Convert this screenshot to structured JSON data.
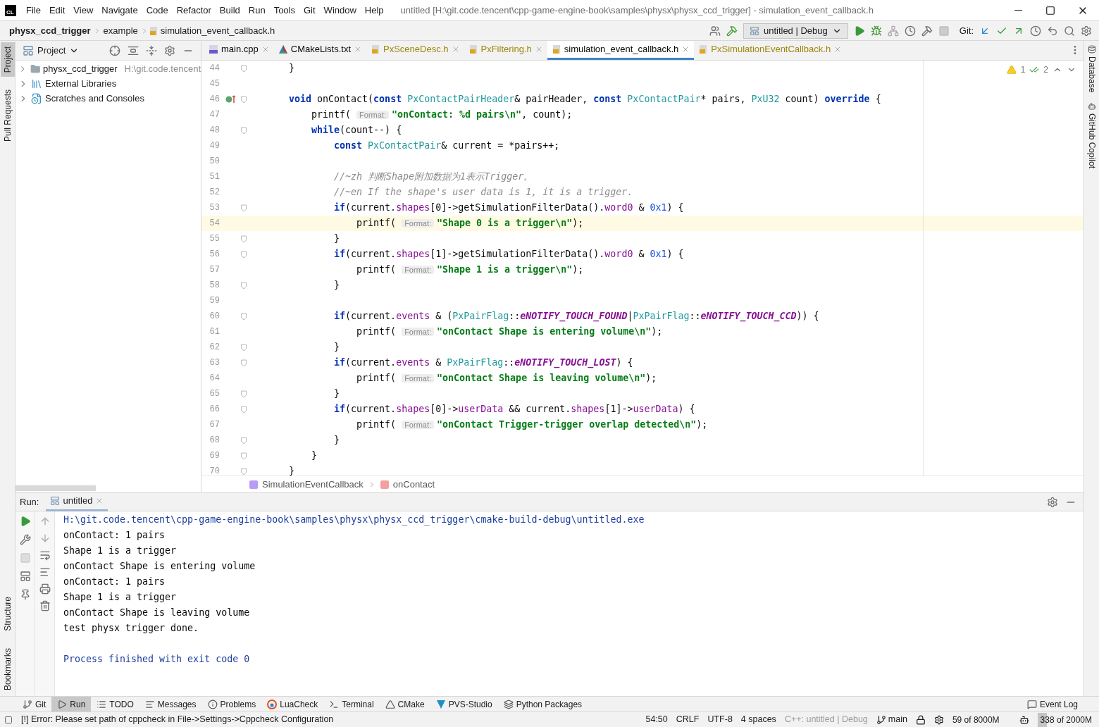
{
  "logo": "CL",
  "menu": [
    "File",
    "Edit",
    "View",
    "Navigate",
    "Code",
    "Refactor",
    "Build",
    "Run",
    "Tools",
    "Git",
    "Window",
    "Help"
  ],
  "window": {
    "title": "untitled [H:\\git.code.tencent\\cpp-game-engine-book\\samples\\physx\\physx_ccd_trigger] - simulation_event_callback.h"
  },
  "breadcrumbs": [
    "physx_ccd_trigger",
    "example",
    "simulation_event_callback.h"
  ],
  "run_config": "untitled | Debug",
  "git_label": "Git:",
  "left_stripe": [
    {
      "label": "Project",
      "selected": true
    },
    {
      "label": "Pull Requests",
      "selected": false
    },
    {
      "label": "Structure",
      "selected": false
    },
    {
      "label": "Bookmarks",
      "selected": false
    }
  ],
  "right_stripe": [
    "Database",
    "GitHub Copilot"
  ],
  "project": {
    "title": "Project",
    "items": [
      {
        "label": "physx_ccd_trigger",
        "hint": "H:\\git.code.tencent",
        "kind": "folder"
      },
      {
        "label": "External Libraries",
        "kind": "library"
      },
      {
        "label": "Scratches and Consoles",
        "kind": "scratch"
      }
    ]
  },
  "tabs": [
    {
      "label": "main.cpp",
      "kind": "cpp",
      "selected": false,
      "color": "#080808"
    },
    {
      "label": "CMakeLists.txt",
      "kind": "cmake",
      "selected": false,
      "color": "#080808"
    },
    {
      "label": "PxSceneDesc.h",
      "kind": "h",
      "selected": false,
      "color": "#9e880d"
    },
    {
      "label": "PxFiltering.h",
      "kind": "h",
      "selected": false,
      "color": "#9e880d"
    },
    {
      "label": "simulation_event_callback.h",
      "kind": "h",
      "selected": true,
      "color": "#080808"
    },
    {
      "label": "PxSimulationEventCallback.h",
      "kind": "h",
      "selected": false,
      "color": "#9e880d"
    }
  ],
  "inspections": {
    "warnings": "1",
    "checks": "2"
  },
  "code": [
    {
      "n": "44",
      "fold": true,
      "override": false,
      "current": false,
      "tokens": [
        {
          "kind": "plain",
          "text": "    }"
        }
      ]
    },
    {
      "n": "45",
      "fold": false,
      "override": false,
      "current": false
    },
    {
      "n": "46",
      "fold": true,
      "override": true,
      "current": false,
      "tokens": [
        {
          "kind": "keyword",
          "text": "    void"
        },
        {
          "kind": "plain",
          "text": " onContact("
        },
        {
          "kind": "keyword",
          "text": "const"
        },
        {
          "kind": "type",
          "text": " PxContactPairHeader"
        },
        {
          "kind": "plain",
          "text": "& pairHeader, "
        },
        {
          "kind": "keyword",
          "text": "const"
        },
        {
          "kind": "type",
          "text": " PxContactPair"
        },
        {
          "kind": "plain",
          "text": "* pairs, "
        },
        {
          "kind": "type",
          "text": "PxU32"
        },
        {
          "kind": "plain",
          "text": " count) "
        },
        {
          "kind": "keyword",
          "text": "override"
        },
        {
          "kind": "plain",
          "text": " {"
        }
      ]
    },
    {
      "n": "47",
      "fold": false,
      "override": false,
      "current": false,
      "tokens": [
        {
          "kind": "plain",
          "text": "        printf( "
        },
        {
          "kind": "hint",
          "text": "Format:"
        },
        {
          "kind": "string",
          "text": "\"onContact: %d pairs\\n\""
        },
        {
          "kind": "plain",
          "text": ", count);"
        }
      ]
    },
    {
      "n": "48",
      "fold": true,
      "override": false,
      "current": false,
      "tokens": [
        {
          "kind": "keyword",
          "text": "        while"
        },
        {
          "kind": "plain",
          "text": "(count--) {"
        }
      ]
    },
    {
      "n": "49",
      "fold": false,
      "override": false,
      "current": false,
      "tokens": [
        {
          "kind": "keyword",
          "text": "            const"
        },
        {
          "kind": "type",
          "text": " PxContactPair"
        },
        {
          "kind": "plain",
          "text": "& current = *pairs++;"
        }
      ]
    },
    {
      "n": "50",
      "fold": false,
      "override": false,
      "current": false
    },
    {
      "n": "51",
      "fold": false,
      "override": false,
      "current": false,
      "tokens": [
        {
          "kind": "comment",
          "text": "            //~zh 判断Shape附加数据为1表示Trigger。"
        }
      ]
    },
    {
      "n": "52",
      "fold": false,
      "override": false,
      "current": false,
      "tokens": [
        {
          "kind": "comment",
          "text": "            //~en If the shape's user data is 1, it is a trigger."
        }
      ]
    },
    {
      "n": "53",
      "fold": true,
      "override": false,
      "current": false,
      "tokens": [
        {
          "kind": "keyword",
          "text": "            if"
        },
        {
          "kind": "plain",
          "text": "(current."
        },
        {
          "kind": "field",
          "text": "shapes"
        },
        {
          "kind": "plain",
          "text": "[0]->getSimulationFilterData()."
        },
        {
          "kind": "field",
          "text": "word0"
        },
        {
          "kind": "plain",
          "text": " & "
        },
        {
          "kind": "number",
          "text": "0x1"
        },
        {
          "kind": "plain",
          "text": ") {"
        }
      ]
    },
    {
      "n": "54",
      "fold": false,
      "override": false,
      "current": true,
      "tokens": [
        {
          "kind": "plain",
          "text": "                printf( "
        },
        {
          "kind": "hint",
          "text": "Format:"
        },
        {
          "kind": "string",
          "text": "\"Shape 0 is a trigger\\n\""
        },
        {
          "kind": "plain",
          "text": ");"
        }
      ]
    },
    {
      "n": "55",
      "fold": true,
      "override": false,
      "current": false,
      "tokens": [
        {
          "kind": "plain",
          "text": "            }"
        }
      ]
    },
    {
      "n": "56",
      "fold": true,
      "override": false,
      "current": false,
      "tokens": [
        {
          "kind": "keyword",
          "text": "            if"
        },
        {
          "kind": "plain",
          "text": "(current."
        },
        {
          "kind": "field",
          "text": "shapes"
        },
        {
          "kind": "plain",
          "text": "[1]->getSimulationFilterData()."
        },
        {
          "kind": "field",
          "text": "word0"
        },
        {
          "kind": "plain",
          "text": " & "
        },
        {
          "kind": "number",
          "text": "0x1"
        },
        {
          "kind": "plain",
          "text": ") {"
        }
      ]
    },
    {
      "n": "57",
      "fold": false,
      "override": false,
      "current": false,
      "tokens": [
        {
          "kind": "plain",
          "text": "                printf( "
        },
        {
          "kind": "hint",
          "text": "Format:"
        },
        {
          "kind": "string",
          "text": "\"Shape 1 is a trigger\\n\""
        },
        {
          "kind": "plain",
          "text": ");"
        }
      ]
    },
    {
      "n": "58",
      "fold": true,
      "override": false,
      "current": false,
      "tokens": [
        {
          "kind": "plain",
          "text": "            }"
        }
      ]
    },
    {
      "n": "59",
      "fold": false,
      "override": false,
      "current": false
    },
    {
      "n": "60",
      "fold": true,
      "override": false,
      "current": false,
      "tokens": [
        {
          "kind": "keyword",
          "text": "            if"
        },
        {
          "kind": "plain",
          "text": "(current."
        },
        {
          "kind": "field",
          "text": "events"
        },
        {
          "kind": "plain",
          "text": " & ("
        },
        {
          "kind": "type",
          "text": "PxPairFlag"
        },
        {
          "kind": "plain",
          "text": "::"
        },
        {
          "kind": "enum",
          "text": "eNOTIFY_TOUCH_FOUND"
        },
        {
          "kind": "plain",
          "text": "|"
        },
        {
          "kind": "type",
          "text": "PxPairFlag"
        },
        {
          "kind": "plain",
          "text": "::"
        },
        {
          "kind": "enum",
          "text": "eNOTIFY_TOUCH_CCD"
        },
        {
          "kind": "plain",
          "text": ")) {"
        }
      ]
    },
    {
      "n": "61",
      "fold": false,
      "override": false,
      "current": false,
      "tokens": [
        {
          "kind": "plain",
          "text": "                printf( "
        },
        {
          "kind": "hint",
          "text": "Format:"
        },
        {
          "kind": "string",
          "text": "\"onContact Shape is entering volume\\n\""
        },
        {
          "kind": "plain",
          "text": ");"
        }
      ]
    },
    {
      "n": "62",
      "fold": true,
      "override": false,
      "current": false,
      "tokens": [
        {
          "kind": "plain",
          "text": "            }"
        }
      ]
    },
    {
      "n": "63",
      "fold": true,
      "override": false,
      "current": false,
      "tokens": [
        {
          "kind": "keyword",
          "text": "            if"
        },
        {
          "kind": "plain",
          "text": "(current."
        },
        {
          "kind": "field",
          "text": "events"
        },
        {
          "kind": "plain",
          "text": " & "
        },
        {
          "kind": "type",
          "text": "PxPairFlag"
        },
        {
          "kind": "plain",
          "text": "::"
        },
        {
          "kind": "enum",
          "text": "eNOTIFY_TOUCH_LOST"
        },
        {
          "kind": "plain",
          "text": ") {"
        }
      ]
    },
    {
      "n": "64",
      "fold": false,
      "override": false,
      "current": false,
      "tokens": [
        {
          "kind": "plain",
          "text": "                printf( "
        },
        {
          "kind": "hint",
          "text": "Format:"
        },
        {
          "kind": "string",
          "text": "\"onContact Shape is leaving volume\\n\""
        },
        {
          "kind": "plain",
          "text": ");"
        }
      ]
    },
    {
      "n": "65",
      "fold": true,
      "override": false,
      "current": false,
      "tokens": [
        {
          "kind": "plain",
          "text": "            }"
        }
      ]
    },
    {
      "n": "66",
      "fold": true,
      "override": false,
      "current": false,
      "tokens": [
        {
          "kind": "keyword",
          "text": "            if"
        },
        {
          "kind": "plain",
          "text": "(current."
        },
        {
          "kind": "field",
          "text": "shapes"
        },
        {
          "kind": "plain",
          "text": "[0]->"
        },
        {
          "kind": "field",
          "text": "userData"
        },
        {
          "kind": "plain",
          "text": " && current."
        },
        {
          "kind": "field",
          "text": "shapes"
        },
        {
          "kind": "plain",
          "text": "[1]->"
        },
        {
          "kind": "field",
          "text": "userData"
        },
        {
          "kind": "plain",
          "text": ") {"
        }
      ]
    },
    {
      "n": "67",
      "fold": false,
      "override": false,
      "current": false,
      "tokens": [
        {
          "kind": "plain",
          "text": "                printf( "
        },
        {
          "kind": "hint",
          "text": "Format:"
        },
        {
          "kind": "string",
          "text": "\"onContact Trigger-trigger overlap detected\\n\""
        },
        {
          "kind": "plain",
          "text": ");"
        }
      ]
    },
    {
      "n": "68",
      "fold": true,
      "override": false,
      "current": false,
      "tokens": [
        {
          "kind": "plain",
          "text": "            }"
        }
      ]
    },
    {
      "n": "69",
      "fold": true,
      "override": false,
      "current": false,
      "tokens": [
        {
          "kind": "plain",
          "text": "        }"
        }
      ]
    },
    {
      "n": "70",
      "fold": true,
      "override": false,
      "current": false,
      "tokens": [
        {
          "kind": "plain",
          "text": "    }"
        }
      ]
    }
  ],
  "code_breadcrumbs": [
    {
      "label": "SimulationEventCallback",
      "kind": "struct"
    },
    {
      "label": "onContact",
      "kind": "function"
    }
  ],
  "run": {
    "label": "Run:",
    "tab": "untitled",
    "output": [
      {
        "text": "H:\\git.code.tencent\\cpp-game-engine-book\\samples\\physx\\physx_ccd_trigger\\cmake-build-debug\\untitled.exe",
        "kind": "command"
      },
      {
        "text": "onContact: 1 pairs",
        "kind": "out"
      },
      {
        "text": "Shape 1 is a trigger",
        "kind": "out"
      },
      {
        "text": "onContact Shape is entering volume",
        "kind": "out"
      },
      {
        "text": "onContact: 1 pairs",
        "kind": "out"
      },
      {
        "text": "Shape 1 is a trigger",
        "kind": "out"
      },
      {
        "text": "onContact Shape is leaving volume",
        "kind": "out"
      },
      {
        "text": "test physx trigger done.",
        "kind": "out"
      },
      {
        "text": "Process finished with exit code 0",
        "kind": "exit"
      }
    ]
  },
  "tool_windows": [
    {
      "label": "Git",
      "kind": "git",
      "selected": false
    },
    {
      "label": "Run",
      "kind": "run",
      "selected": true
    },
    {
      "label": "TODO",
      "kind": "todo",
      "selected": false
    },
    {
      "label": "Messages",
      "kind": "messages",
      "selected": false
    },
    {
      "label": "Problems",
      "kind": "problems",
      "selected": false
    },
    {
      "label": "LuaCheck",
      "kind": "luacheck",
      "selected": false
    },
    {
      "label": "Terminal",
      "kind": "terminal",
      "selected": false
    },
    {
      "label": "CMake",
      "kind": "cmake",
      "selected": false
    },
    {
      "label": "PVS-Studio",
      "kind": "pvs",
      "selected": false
    },
    {
      "label": "Python Packages",
      "kind": "python",
      "selected": false
    }
  ],
  "event_log": "Event Log",
  "status_bar": {
    "message": "[!] Error: Please set path of cppcheck in File->Settings->Cppcheck Configuration",
    "position": "54:50",
    "line_separator": "CRLF",
    "encoding": "UTF-8",
    "indent": "4 spaces",
    "context": "C++: untitled | Debug",
    "branch": "main",
    "memory_a": "59 of 8000M",
    "memory_b": {
      "text": "338 of 2000M",
      "level": 0.17
    }
  }
}
